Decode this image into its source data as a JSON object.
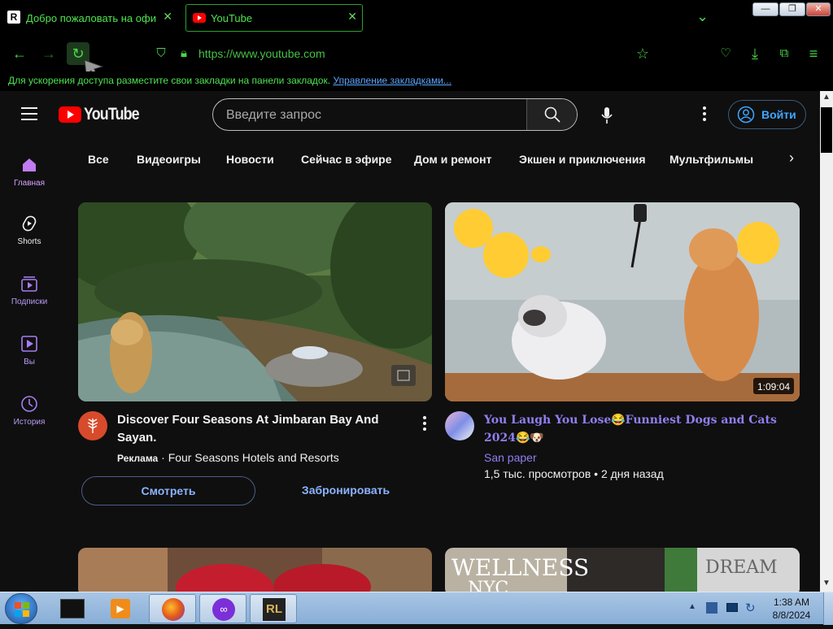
{
  "browser": {
    "tabs": [
      {
        "title": "Добро пожаловать на официа",
        "close": "✕"
      },
      {
        "title": "YouTube",
        "close": "✕"
      }
    ],
    "url": "https://www.youtube.com",
    "bookmarks_hint": "Для ускорения доступа разместите свои закладки на панели закладок.",
    "bookmarks_link": "Управление закладками...",
    "tab_list": "⌄"
  },
  "youtube": {
    "logo_text": "YouTube",
    "search_placeholder": "Введите запрос",
    "signin_label": "Войти",
    "chips": [
      "Все",
      "Видеоигры",
      "Новости",
      "Сейчас в эфире",
      "Дом и ремонт",
      "Экшен и приключения",
      "Мультфильмы"
    ],
    "sidebar": [
      {
        "label": "Главная",
        "icon": "home-icon"
      },
      {
        "label": "Shorts",
        "icon": "shorts-icon"
      },
      {
        "label": "Подписки",
        "icon": "subscriptions-icon"
      },
      {
        "label": "Вы",
        "icon": "you-icon"
      },
      {
        "label": "История",
        "icon": "history-icon"
      }
    ],
    "ad_card": {
      "title": "Discover Four Seasons At Jimbaran Bay And Sayan.",
      "badge": "Реклама",
      "separator": " · ",
      "advertiser": "Four Seasons Hotels and Resorts",
      "watch_label": "Смотреть",
      "book_label": "Забронировать"
    },
    "video_card": {
      "title": "You Laugh You Lose😂Funniest Dogs and Cats 2024😂🐶",
      "channel": "San paper",
      "stats": "1,5 тыс. просмотров • 2 дня назад",
      "duration": "1:09:04"
    },
    "lower_thumb_text_a": "WELLNESS",
    "lower_thumb_text_b": "NYC",
    "lower_thumb_text_c": "DREAM"
  },
  "taskbar": {
    "time": "1:38 AM",
    "date": "8/8/2024"
  },
  "colors": {
    "chrome_green": "#4ee44e",
    "yt_red": "#ff0000",
    "yt_blue": "#3ea6ff",
    "taskbar": "#99bbe0"
  }
}
